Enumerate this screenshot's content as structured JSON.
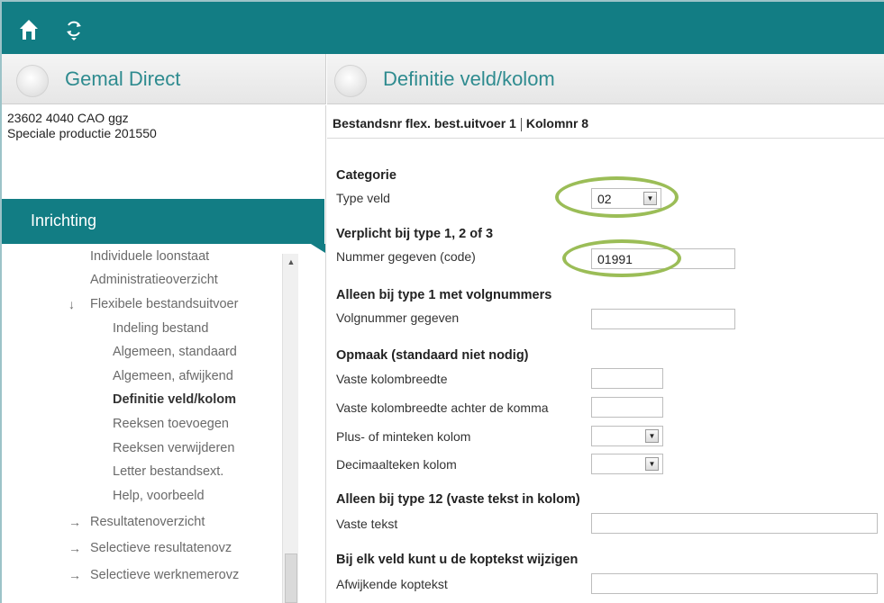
{
  "topbar": {
    "home_icon": "home-icon",
    "sync_icon": "sync-icon"
  },
  "left_header": {
    "title": "Gemal Direct"
  },
  "right_header": {
    "title": "Definitie veld/kolom"
  },
  "info": {
    "line1": "23602 4040 CAO ggz",
    "line2": "Speciale productie  201550"
  },
  "sidebar": {
    "section_title": "Inrichting",
    "items": [
      {
        "label": "Individuele loonstaat",
        "arrow": "",
        "level": 1
      },
      {
        "label": "Administratieoverzicht",
        "arrow": "",
        "level": 1
      },
      {
        "label": "Flexibele bestandsuitvoer",
        "arrow": "↓",
        "level": 1
      },
      {
        "label": "Indeling bestand",
        "arrow": "",
        "level": 2
      },
      {
        "label": "Algemeen, standaard",
        "arrow": "",
        "level": 2
      },
      {
        "label": "Algemeen, afwijkend",
        "arrow": "",
        "level": 2
      },
      {
        "label": "Definitie veld/kolom",
        "arrow": "",
        "level": 2,
        "active": true
      },
      {
        "label": "Reeksen toevoegen",
        "arrow": "",
        "level": 2
      },
      {
        "label": "Reeksen verwijderen",
        "arrow": "",
        "level": 2
      },
      {
        "label": "Letter bestandsext.",
        "arrow": "",
        "level": 2
      },
      {
        "label": "Help, voorbeeld",
        "arrow": "",
        "level": 2
      },
      {
        "label": "Resultatenoverzicht",
        "arrow": "→",
        "level": 1
      },
      {
        "label": "Selectieve resultatenovz",
        "arrow": "→",
        "level": 1
      },
      {
        "label": "Selectieve werknemerovz",
        "arrow": "→",
        "level": 1
      }
    ]
  },
  "breadcrumb": {
    "part1": "Bestandsnr flex. best.uitvoer 1",
    "part2": "Kolomnr 8"
  },
  "form": {
    "categorie": {
      "heading": "Categorie",
      "type_veld_label": "Type veld",
      "type_veld_value": "02"
    },
    "verplicht": {
      "heading": "Verplicht bij type 1, 2 of 3",
      "nummer_label": "Nummer gegeven (code)",
      "nummer_value": "01991"
    },
    "volgnummers": {
      "heading": "Alleen bij type 1 met volgnummers",
      "volgnummer_label": "Volgnummer gegeven",
      "volgnummer_value": ""
    },
    "opmaak": {
      "heading": "Opmaak (standaard niet nodig)",
      "kolombreedte_label": "Vaste kolombreedte",
      "kolombreedte_value": "",
      "achter_komma_label": "Vaste kolombreedte achter de komma",
      "achter_komma_value": "",
      "plusmin_label": "Plus- of minteken kolom",
      "plusmin_value": "",
      "decimaal_label": "Decimaalteken kolom",
      "decimaal_value": ""
    },
    "type12": {
      "heading": "Alleen bij type 12 (vaste tekst in kolom)",
      "vaste_tekst_label": "Vaste tekst",
      "vaste_tekst_value": ""
    },
    "koptekst": {
      "heading": "Bij elk veld kunt u de koptekst wijzigen",
      "afwijkend_label": "Afwijkende koptekst",
      "afwijkend_value": ""
    }
  },
  "colors": {
    "teal": "#127d84",
    "highlight": "#9bbd57"
  }
}
